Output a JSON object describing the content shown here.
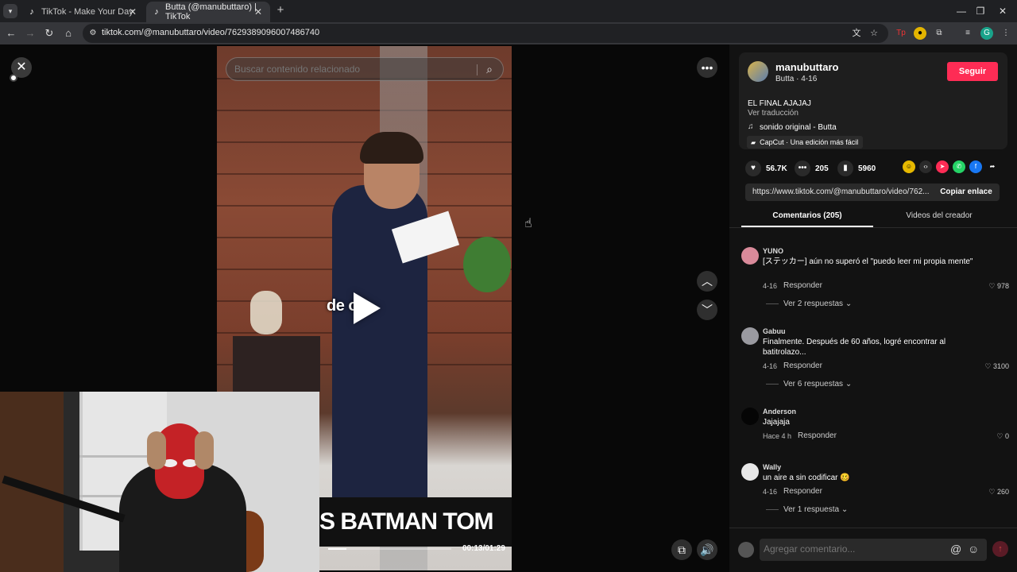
{
  "browser": {
    "tabs": [
      {
        "title": "TikTok - Make Your Day"
      },
      {
        "title": "Butta (@manubuttaro) | TikTok"
      }
    ],
    "url": "tiktok.com/@manubuttaro/video/7629389096007486740",
    "icons": {
      "tab_menu": "chevron-down-icon",
      "tab_favicon": "tiktok-icon",
      "new_tab": "plus-icon",
      "back": "arrow-left-icon",
      "forward": "arrow-right-icon",
      "reload": "reload-icon",
      "home": "home-icon"
    }
  },
  "video": {
    "search_placeholder": "Buscar contenido relacionado",
    "overlay_text": "de     o?",
    "caption_text": "S BATMAN TOM",
    "time": "00:13/01:29",
    "progress": 0.146
  },
  "creator": {
    "handle": "manubuttaro",
    "sub": "Butta · 4-16",
    "follow_label": "Seguir",
    "caption": "EL FINAL AJAJAJ",
    "see_translation": "Ver traducción",
    "music": "sonido original - Butta",
    "capcut": "CapCut · Una edición más fácil"
  },
  "stats": {
    "likes": "56.7K",
    "comments": "205",
    "saves": "5960"
  },
  "link": {
    "url": "https://www.tiktok.com/@manubuttaro/video/762...",
    "copy_label": "Copiar enlace"
  },
  "tabs": {
    "comments": "Comentarios (205)",
    "videos": "Videos del creador"
  },
  "comments": [
    {
      "user": "YUNO",
      "text": "[ステッカー] aún no superó el \"puedo leer mi propia mente\"",
      "date": "4-16",
      "reply": "Responder",
      "likes": "978",
      "thread": "Ver 2 respuestas"
    },
    {
      "user": "Gabuu",
      "text": "Finalmente. Después de 60 años, logré encontrar al batitrolazo...",
      "date": "4-16",
      "reply": "Responder",
      "likes": "3100",
      "thread": "Ver 6 respuestas"
    },
    {
      "user": "Anderson",
      "text": "Jajajaja",
      "date": "Hace 4 h",
      "reply": "Responder",
      "likes": "0",
      "thread": ""
    },
    {
      "user": "Wally",
      "text": "un aire a sin codificar 🥴",
      "date": "4-16",
      "reply": "Responder",
      "likes": "260",
      "thread": "Ver 1 respuesta"
    }
  ],
  "composer": {
    "placeholder": "Agregar comentario..."
  },
  "colors": {
    "follow": "#fe2c55",
    "sidebar_bg": "#121212",
    "card_bg": "#1e1e1e"
  }
}
